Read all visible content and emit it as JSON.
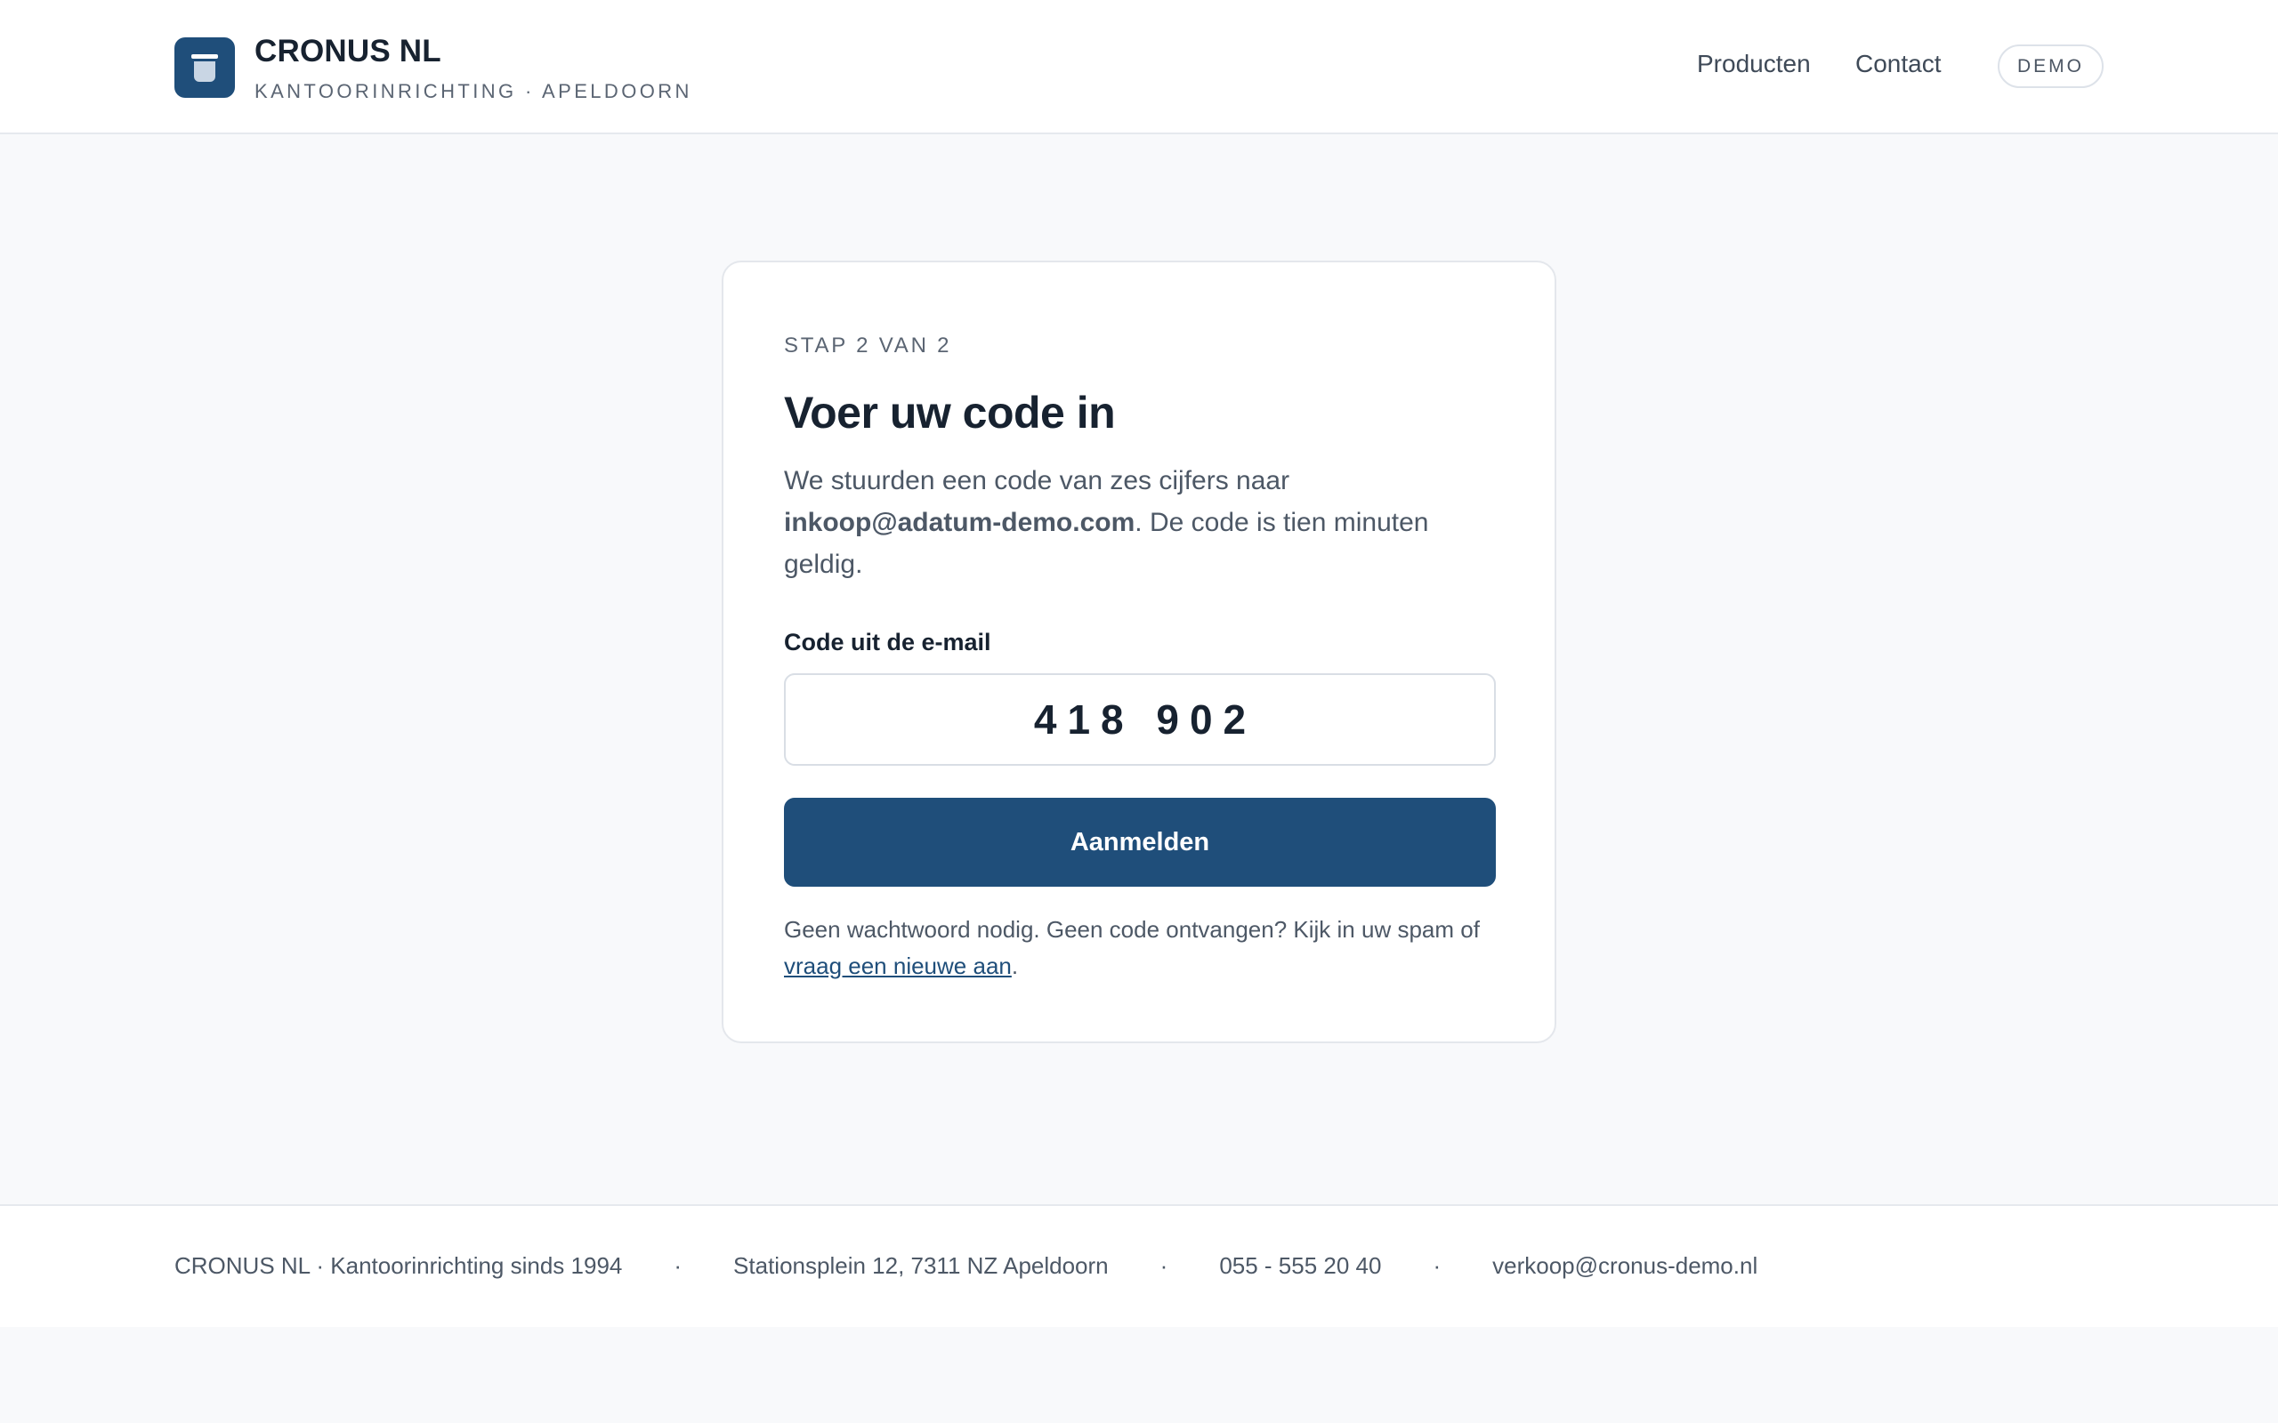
{
  "header": {
    "brand_name": "CRONUS NL",
    "brand_sub": "KANTOORINRICHTING · APELDOORN",
    "nav": [
      {
        "label": "Producten"
      },
      {
        "label": "Contact"
      }
    ],
    "badge": "DEMO"
  },
  "card": {
    "step": "STAP 2 VAN 2",
    "title": "Voer uw code in",
    "desc_prefix": "We stuurden een code van zes cijfers naar ",
    "desc_email": "inkoop@adatum-demo.com",
    "desc_suffix": ". De code is tien minuten geldig.",
    "field_label": "Code uit de e-mail",
    "code_value": "418 902",
    "submit_label": "Aanmelden",
    "help_prefix": "Geen wachtwoord nodig. Geen code ontvangen? Kijk in uw spam of ",
    "help_link": "vraag een nieuwe aan",
    "help_suffix": "."
  },
  "footer": {
    "items": [
      "CRONUS NL · Kantoorinrichting sinds 1994",
      "Stationsplein 12, 7311 NZ Apeldoorn",
      "055 - 555 20 40",
      "verkoop@cronus-demo.nl"
    ],
    "separator": "·"
  },
  "colors": {
    "brand": "#1f4e7a",
    "background": "#f8f9fb",
    "text": "#172230",
    "muted": "#4d5866"
  },
  "icons": {
    "logo": "trash-bin-icon"
  }
}
